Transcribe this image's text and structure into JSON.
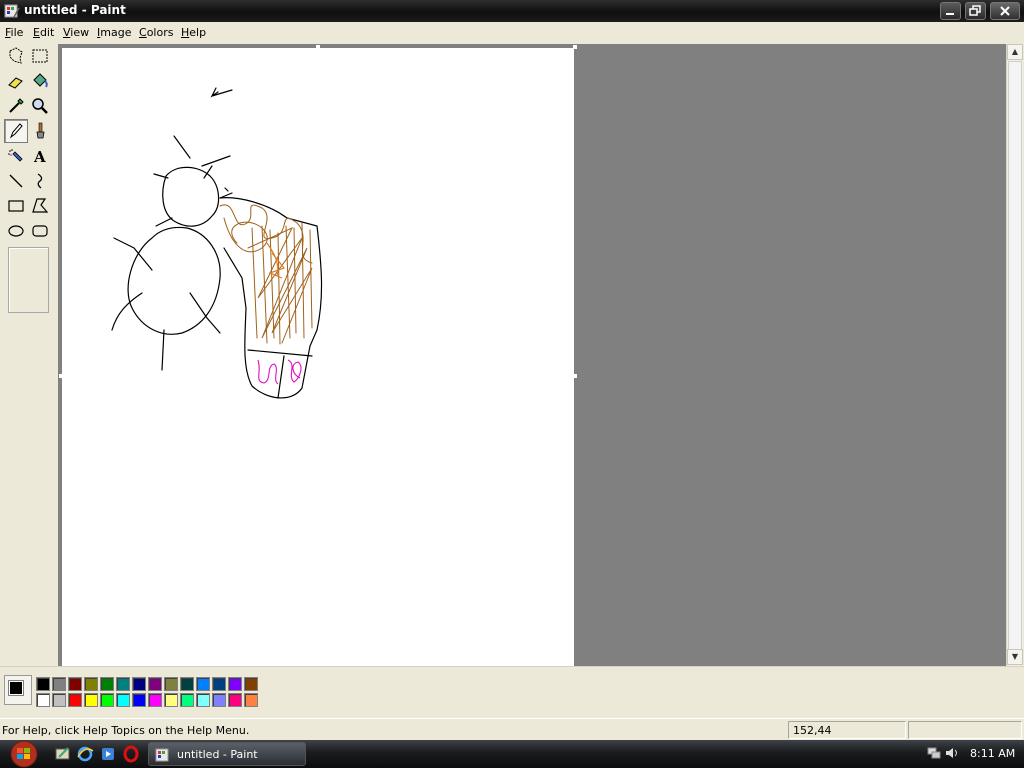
{
  "window": {
    "title": "untitled - Paint"
  },
  "menu": [
    "File",
    "Edit",
    "View",
    "Image",
    "Colors",
    "Help"
  ],
  "tools": [
    {
      "name": "free-form-select",
      "icon": "free-select-icon"
    },
    {
      "name": "select",
      "icon": "rect-select-icon"
    },
    {
      "name": "eraser",
      "icon": "eraser-icon"
    },
    {
      "name": "fill-with-color",
      "icon": "fill-bucket-icon"
    },
    {
      "name": "pick-color",
      "icon": "eyedropper-icon"
    },
    {
      "name": "magnifier",
      "icon": "magnifier-icon"
    },
    {
      "name": "pencil",
      "icon": "pencil-icon",
      "selected": true
    },
    {
      "name": "brush",
      "icon": "brush-icon"
    },
    {
      "name": "airbrush",
      "icon": "airbrush-icon"
    },
    {
      "name": "text",
      "icon": "text-icon",
      "label": "A"
    },
    {
      "name": "line",
      "icon": "line-icon"
    },
    {
      "name": "curve",
      "icon": "curve-icon"
    },
    {
      "name": "rectangle",
      "icon": "rectangle-icon"
    },
    {
      "name": "polygon",
      "icon": "polygon-icon"
    },
    {
      "name": "ellipse",
      "icon": "ellipse-icon"
    },
    {
      "name": "rounded-rectangle",
      "icon": "rounded-rect-icon"
    }
  ],
  "colors": {
    "foreground": "#000000",
    "background": "#ffffff",
    "palette_top": [
      "#000000",
      "#808080",
      "#800000",
      "#808000",
      "#008000",
      "#008080",
      "#000080",
      "#800080",
      "#808040",
      "#004040",
      "#0080ff",
      "#004080",
      "#8000ff",
      "#804000"
    ],
    "palette_bottom": [
      "#ffffff",
      "#c0c0c0",
      "#ff0000",
      "#ffff00",
      "#00ff00",
      "#00ffff",
      "#0000ff",
      "#ff00ff",
      "#ffff80",
      "#00ff80",
      "#80ffff",
      "#8080ff",
      "#ff0080",
      "#ff8040"
    ]
  },
  "status": {
    "help_text": "For Help, click Help Topics on the Help Menu.",
    "coords": "152,44",
    "size": ""
  },
  "taskbar": {
    "window_button": "untitled - Paint",
    "clock": "8:11 AM"
  }
}
